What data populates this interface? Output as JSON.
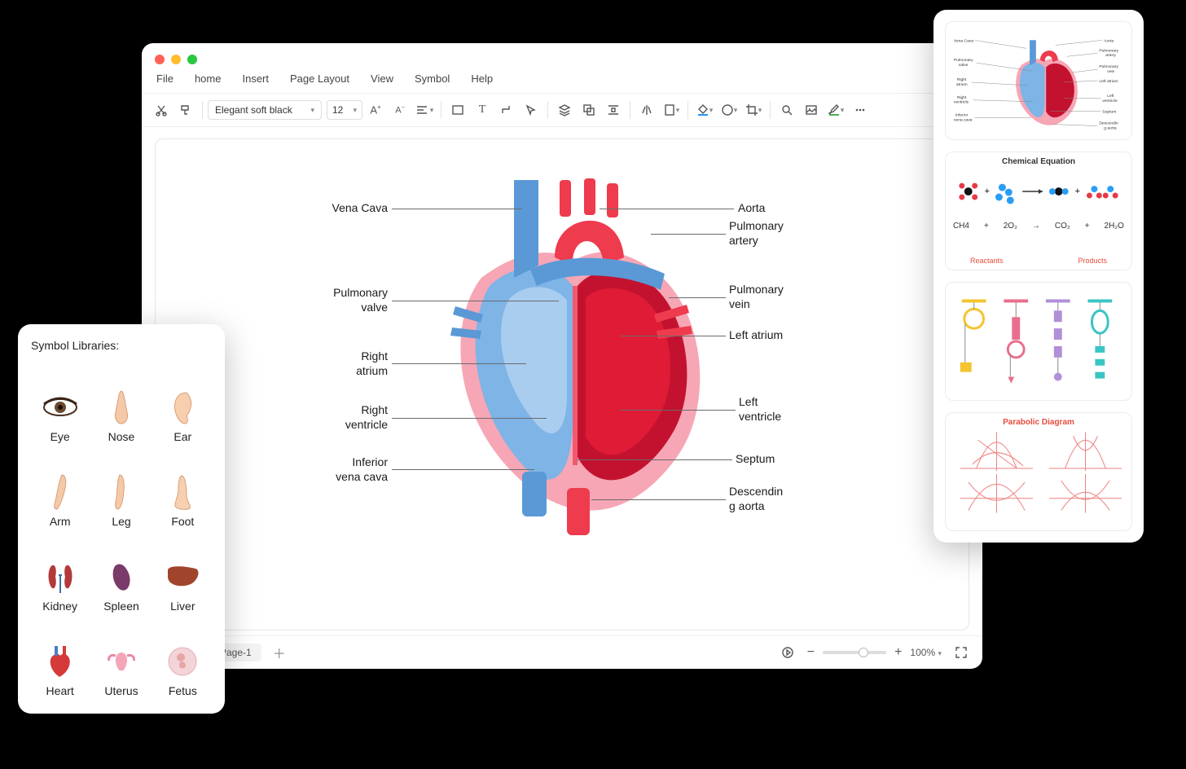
{
  "menu": {
    "items": [
      "File",
      "home",
      "Insert",
      "Page Layout",
      "View",
      "Symbol",
      "Help"
    ]
  },
  "toolbar": {
    "font": "Elegant soft black",
    "size": "12"
  },
  "heart_labels": {
    "left": [
      {
        "text": "Vena Cava"
      },
      {
        "text": "Pulmonary\nvalve"
      },
      {
        "text": "Right\natrium"
      },
      {
        "text": "Right\nventricle"
      },
      {
        "text": "Inferior\nvena cava"
      }
    ],
    "right": [
      {
        "text": "Aorta"
      },
      {
        "text": "Pulmonary\nartery"
      },
      {
        "text": "Pulmonary\nvein"
      },
      {
        "text": "Left atrium"
      },
      {
        "text": "Left\nventricle"
      },
      {
        "text": "Septum"
      },
      {
        "text": "Descendin\ng aorta"
      }
    ]
  },
  "status": {
    "page_tab": "Page-1",
    "zoom": "100%"
  },
  "symbol_panel": {
    "title": "Symbol Libraries:",
    "items": [
      "Eye",
      "Nose",
      "Ear",
      "Arm",
      "Leg",
      "Foot",
      "Kidney",
      "Spleen",
      "Liver",
      "Heart",
      "Uterus",
      "Fetus"
    ]
  },
  "templates": {
    "card2_title": "Chemical Equation",
    "card2_left": "Reactants",
    "card2_right": "Products",
    "card2_eq": [
      "CH4",
      "+",
      "2O₂",
      "→",
      "CO₂",
      "+",
      "2H₂O"
    ],
    "card4_title": "Parabolic Diagram",
    "card1_labels_left": [
      "Vena Cava",
      "Pulmonary valve",
      "Right atrium",
      "Right ventricle",
      "Inferior vena cava"
    ],
    "card1_labels_right": [
      "Aorta",
      "Pulmonary artery",
      "Pulmonary vein",
      "Left atrium",
      "Left ventricle",
      "Septum",
      "Descending aorta"
    ]
  }
}
